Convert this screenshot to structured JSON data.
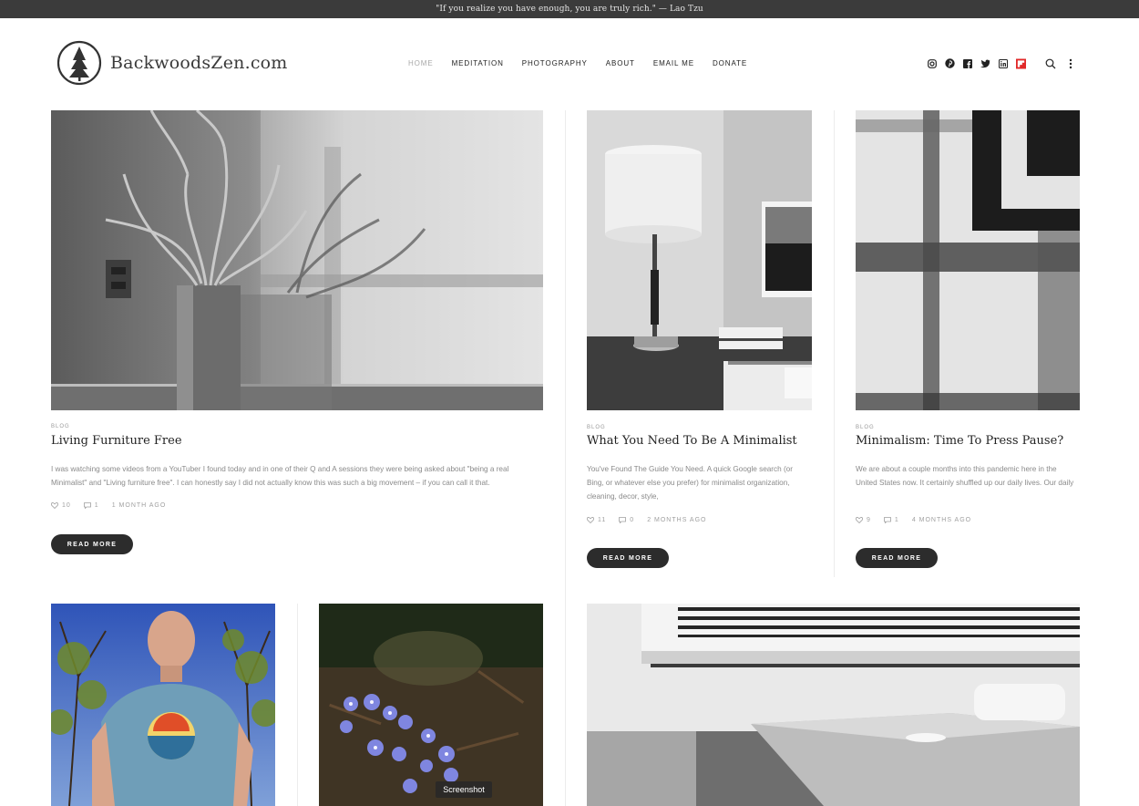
{
  "topbar": {
    "quote": "\"If you realize you have enough, you are truly rich.\" — Lao Tzu"
  },
  "site": {
    "name": "BackwoodsZen.com"
  },
  "nav": {
    "items": [
      {
        "label": "HOME"
      },
      {
        "label": "MEDITATION"
      },
      {
        "label": "PHOTOGRAPHY"
      },
      {
        "label": "ABOUT"
      },
      {
        "label": "EMAIL ME"
      },
      {
        "label": "DONATE"
      }
    ]
  },
  "social_icons": [
    "instagram-icon",
    "pinterest-icon",
    "facebook-icon",
    "twitter-icon",
    "linkedin-icon",
    "flipboard-icon"
  ],
  "utility_icons": [
    "search-icon",
    "more-vertical-icon"
  ],
  "posts": [
    {
      "category": "BLOG",
      "title": "Living Furniture Free",
      "excerpt": "I was watching some videos from a YouTuber I found today and in one of their Q and A sessions they were being asked about \"being a real Minimalist\" and \"Living furniture free\". I can honestly say I did not actually know this was such a big movement – if you can call it that.",
      "likes": "10",
      "comments": "1",
      "date": "1 MONTH AGO",
      "button": "READ MORE"
    },
    {
      "category": "BLOG",
      "title": "What You Need To Be A Minimalist",
      "excerpt": "You've Found The Guide You Need.   A quick Google search (or Bing, or whatever else you prefer) for minimalist organization, cleaning, decor, style,",
      "likes": "11",
      "comments": "0",
      "date": "2 MONTHS AGO",
      "button": "READ MORE"
    },
    {
      "category": "BLOG",
      "title": "Minimalism: Time To Press Pause?",
      "excerpt": "We are about a couple months into this pandemic here in the United States now. It certainly shuffled up our daily lives. Our daily",
      "likes": "9",
      "comments": "1",
      "date": "4 MONTHS AGO",
      "button": "READ MORE"
    }
  ],
  "tooltip": {
    "label": "Screenshot"
  },
  "colors": {
    "topbar": "#3b3b3b",
    "button": "#2c2c2c",
    "flipboard": "#e12828"
  }
}
